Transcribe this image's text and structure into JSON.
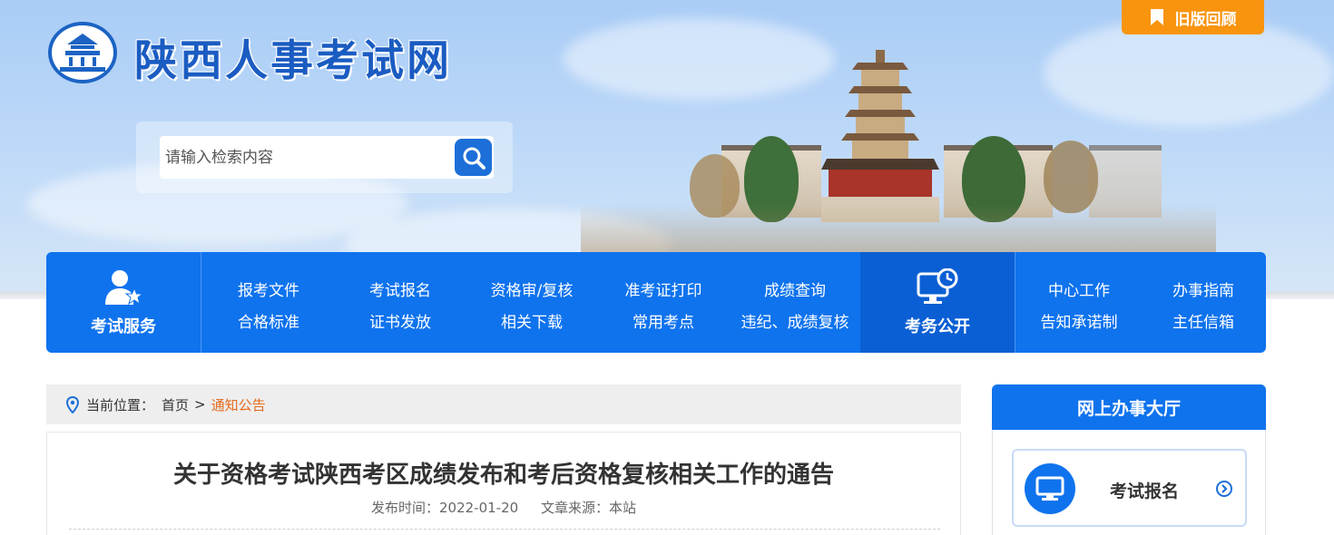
{
  "site": {
    "title": "陕西人事考试网",
    "old_version_label": "旧版回顾"
  },
  "search": {
    "placeholder": "请输入检索内容"
  },
  "nav": {
    "exam_service_label": "考试服务",
    "affairs_label": "考务公开",
    "exam_links": [
      "报考文件",
      "考试报名",
      "资格审/复核",
      "准考证打印",
      "成绩查询",
      "合格标准",
      "证书发放",
      "相关下载",
      "常用考点",
      "违纪、成绩复核"
    ],
    "affairs_links": [
      "中心工作",
      "办事指南",
      "告知承诺制",
      "主任信箱"
    ]
  },
  "breadcrumb": {
    "prefix": "当前位置：",
    "home": "首页",
    "separator": ">",
    "current": "通知公告"
  },
  "article": {
    "title": "关于资格考试陕西考区成绩发布和考后资格复核相关工作的通告",
    "publish_label": "发布时间：",
    "publish_date": "2022-01-20",
    "source_label": "文章来源：",
    "source": "本站"
  },
  "sidebar": {
    "title": "网上办事大厅",
    "card_label": "考试报名"
  },
  "colors": {
    "primary": "#0f73ee",
    "brand_text": "#1b5cc2",
    "accent_orange": "#f8940e",
    "breadcrumb_current": "#e56a1c"
  },
  "icons": {
    "logo": "pagoda-emblem-icon",
    "old_version": "bookmark-icon",
    "search": "magnifier-icon",
    "exam_service": "user-star-icon",
    "affairs": "monitor-clock-icon",
    "location": "location-pin-icon",
    "card": "monitor-icon",
    "card_arrow": "chevron-circle-right-icon"
  }
}
